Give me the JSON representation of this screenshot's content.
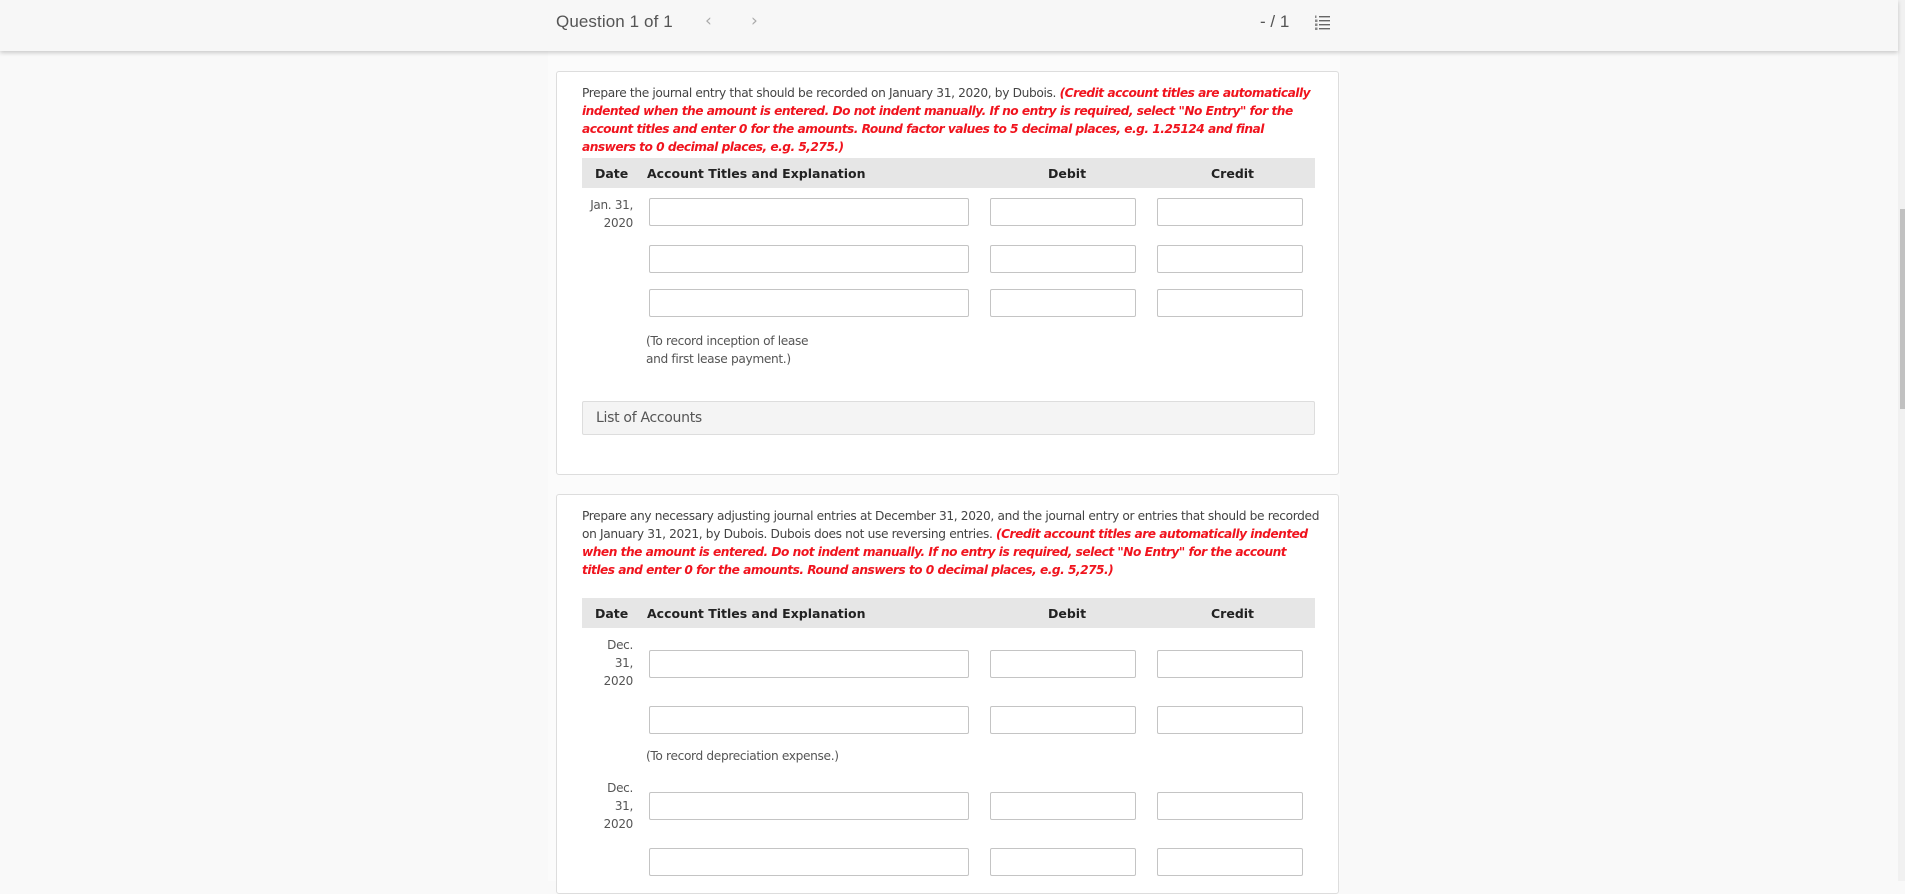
{
  "header": {
    "question_label": "Question 1 of 1",
    "prev_icon": "‹",
    "next_icon": "›",
    "score": "- / 1",
    "list_icon": "numbered-list-icon"
  },
  "part1": {
    "prompt_plain": "Prepare the journal entry that should be recorded on January 31, 2020, by Dubois. ",
    "prompt_red": "(Credit account titles are automatically indented when the amount is entered. Do not indent manually. If no entry is required, select \"No Entry\" for the account titles and enter 0 for the amounts. Round factor values to 5 decimal places, e.g. 1.25124 and final answers to 0 decimal places, e.g. 5,275.)",
    "columns": {
      "date": "Date",
      "account": "Account Titles and Explanation",
      "debit": "Debit",
      "credit": "Credit"
    },
    "date": "Jan. 31, 2020",
    "rows": [
      {
        "account": "",
        "debit": "",
        "credit": ""
      },
      {
        "account": "",
        "debit": "",
        "credit": ""
      },
      {
        "account": "",
        "debit": "",
        "credit": ""
      }
    ],
    "explanation_line1": "(To record inception of lease",
    "explanation_line2": "and first lease payment.)",
    "list_of_accounts": "List of Accounts"
  },
  "part2": {
    "prompt_plain": "Prepare any necessary adjusting journal entries at December 31, 2020, and the journal entry or entries that should be recorded on January 31, 2021, by Dubois. Dubois does not use reversing entries. ",
    "prompt_red": "(Credit account titles are automatically indented when the amount is entered. Do not indent manually. If no entry is required, select \"No Entry\" for the account titles and enter 0 for the amounts. Round answers to 0 decimal places, e.g. 5,275.)",
    "columns": {
      "date": "Date",
      "account": "Account Titles and Explanation",
      "debit": "Debit",
      "credit": "Credit"
    },
    "entry1": {
      "date_line1": "Dec.",
      "date_line2": "31,",
      "date_line3": "2020",
      "rows": [
        {
          "account": "",
          "debit": "",
          "credit": ""
        },
        {
          "account": "",
          "debit": "",
          "credit": ""
        }
      ],
      "explanation": "(To record depreciation expense.)"
    },
    "entry2": {
      "date_line1": "Dec.",
      "date_line2": "31,",
      "date_line3": "2020",
      "rows": [
        {
          "account": "",
          "debit": "",
          "credit": ""
        },
        {
          "account": "",
          "debit": "",
          "credit": ""
        }
      ]
    }
  }
}
